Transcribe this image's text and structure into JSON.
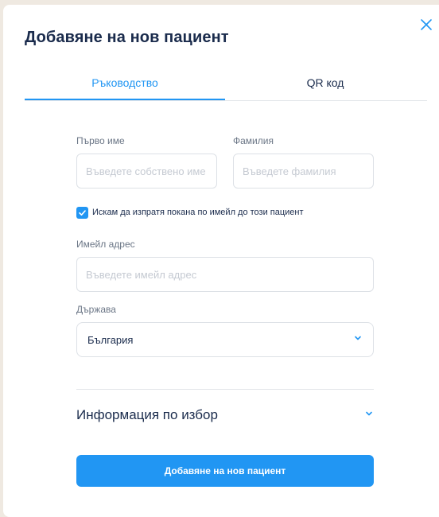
{
  "modal": {
    "title": "Добавяне на нов пациент"
  },
  "tabs": [
    {
      "label": "Ръководство",
      "active": true
    },
    {
      "label": "QR код",
      "active": false
    }
  ],
  "form": {
    "first_name": {
      "label": "Първо име",
      "placeholder": "Въведете собствено име",
      "value": ""
    },
    "last_name": {
      "label": "Фамилия",
      "placeholder": "Въведете фамилия",
      "value": ""
    },
    "invite": {
      "label": "Искам да изпратя покана по имейл до този пациент",
      "checked": true
    },
    "email": {
      "label": "Имейл адрес",
      "placeholder": "Въведете имейл адрес",
      "value": ""
    },
    "country": {
      "label": "Държава",
      "value": "България"
    },
    "optional_section": {
      "label": "Информация по избор"
    },
    "submit_label": "Добавяне на нов пациент"
  },
  "icons": {
    "close": "close-icon",
    "check": "check-icon",
    "chevron": "chevron-down-icon"
  },
  "colors": {
    "accent": "#2196f3",
    "text": "#1a2b4c",
    "muted": "#6b7686",
    "backdrop": "#efe9e1"
  }
}
